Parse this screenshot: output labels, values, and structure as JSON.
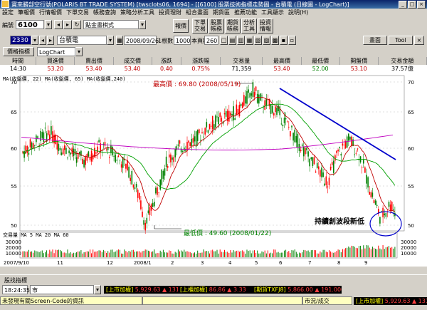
{
  "window": {
    "title": "寶來勝部空行號(POLARIS BT TRADE SYSTEM)  [twsclots06, 1694] - [[6100] 股票技術指標走勢圖 - 台積電 (日線圖 - LogChart)]"
  },
  "menu": [
    "設定",
    "筆報價",
    "行情報價",
    "下單交易",
    "帳務查詢",
    "策略分析工具",
    "投資理財",
    "組合畫面",
    "期貨區",
    "推薦功能",
    "工具顯示",
    "說明(H)"
  ],
  "toolbar": {
    "screen_label": "編號",
    "screen_code": "6100",
    "mode_value": "點金畫棋式",
    "btn_quote": "報價",
    "tb_buttons": [
      "下單\n交易",
      "股票\n帳務",
      "期貨\n帳務",
      "分析\n工具",
      "投資\n情報"
    ]
  },
  "toolbar2": {
    "stock_code": "2330",
    "stock_name": "台積電",
    "date": "2008/09/26",
    "count_label": "1根數目",
    "count_value": "1000",
    "show_label": "本頁顯示",
    "show_value": "260",
    "right_btns": [
      "畫面",
      "Tool"
    ]
  },
  "toolbar3": {
    "indicator_btn": "價格指標",
    "chart_type": "LogChart"
  },
  "quote": {
    "headers": [
      "時間",
      "買進價",
      "賣出價",
      "成交價",
      "漲跌",
      "漲跌幅",
      "交易量",
      "最高價",
      "最低價",
      "開盤價",
      "交易金額"
    ],
    "values": [
      "14:30",
      "53.20",
      "53.40",
      "53.40",
      "0.40",
      "0.75%",
      "71,359",
      "53.40",
      "52.00",
      "53.10",
      "37.57億"
    ]
  },
  "chart": {
    "ma_legend": "MA(收盤價, 22)  MA(收盤價, 65)  MA(收盤價,240)",
    "high_label": "最高價 : 69.80 (2008/05/19)",
    "low_label": "最低價 : 49.60 (2008/01/22)",
    "annotation": "持續創波段新低",
    "vol_legend": "交易量  MA  5  MA 20  MA 60",
    "y_ticks": [
      "70",
      "65",
      "60",
      "55",
      "50"
    ],
    "vol_ticks": [
      "30000",
      "20000",
      "10000"
    ],
    "x_ticks": [
      "2007/9/10",
      "11",
      "12",
      "2008/1",
      "2",
      "3",
      "4",
      "5",
      "6",
      "7",
      "8",
      "9"
    ],
    "colors": {
      "up": "#ff0000",
      "down": "#008000",
      "ma22": "#c00000",
      "ma65": "#00a000",
      "ma240": "#c000c0",
      "trend": "#0000cc"
    }
  },
  "bottom": {
    "tab_label": "股找指標",
    "time": "18:24:35",
    "market": "市",
    "tickers": [
      {
        "name": "上市加權",
        "value": "5,929.63",
        "change": "131.20"
      },
      {
        "name": "上櫃加權",
        "value": "86.86",
        "change": "3.33"
      },
      {
        "name": "期貨TXFJ8",
        "value": "5,866.00",
        "change": "191.000"
      }
    ],
    "status_msg": "未發現有關Screen-Code的資訊",
    "status_mid": "市況/成交",
    "status_right": {
      "name": "上市加權",
      "value": "5,929.63",
      "change": "131.20"
    }
  }
}
